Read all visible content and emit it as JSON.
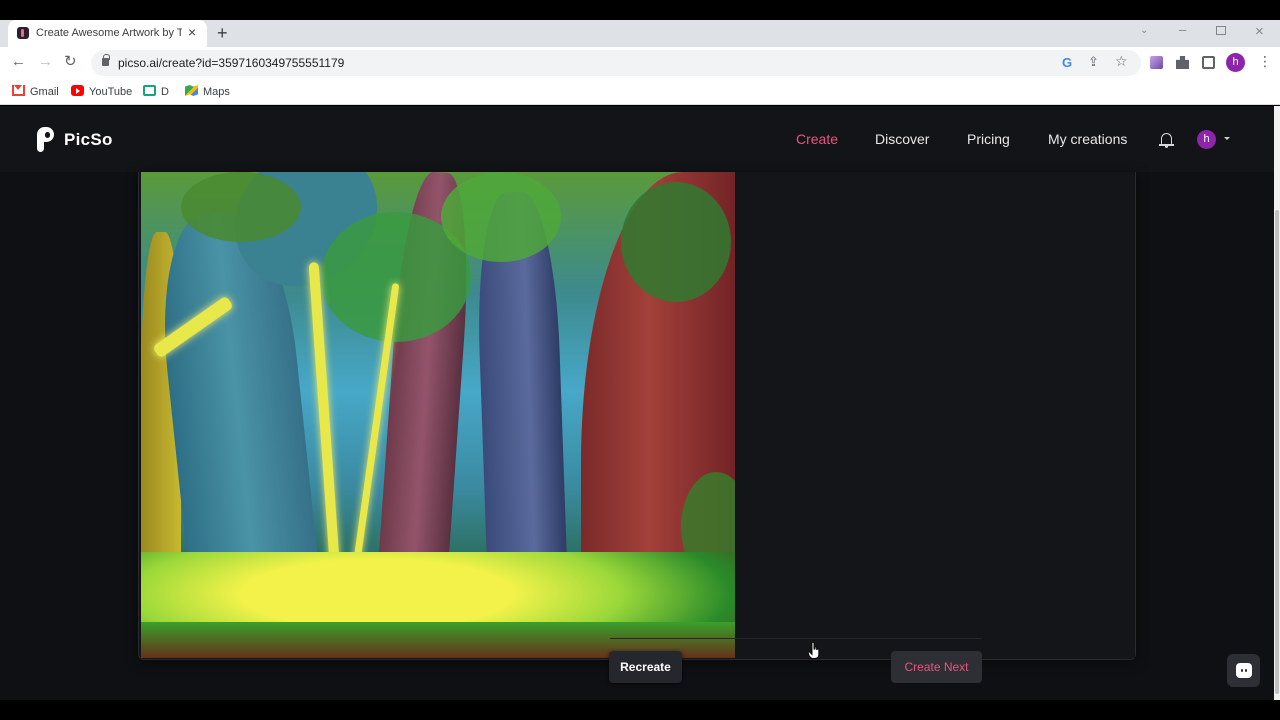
{
  "browser": {
    "tab_title": "Create Awesome Artwork by Typ",
    "url": "picso.ai/create?id=3597160349755551179",
    "profile_initial": "h",
    "bookmarks": [
      {
        "label": "Gmail",
        "icon": "gmail-icon"
      },
      {
        "label": "YouTube",
        "icon": "youtube-icon"
      },
      {
        "label": "D",
        "icon": "d-icon"
      },
      {
        "label": "Maps",
        "icon": "maps-icon"
      }
    ]
  },
  "site": {
    "brand": "PicSo",
    "brand_color": "#e75480",
    "nav": {
      "create": "Create",
      "discover": "Discover",
      "pricing": "Pricing",
      "my_creations": "My creations"
    },
    "active_nav": "Create",
    "user_initial": "h"
  },
  "result": {
    "artwork_description_icon": "forest-painting-image",
    "recreate_label": "Recreate",
    "create_next_label": "Create Next"
  },
  "icons": {
    "bell": "bell-icon",
    "chat": "chat-icon",
    "cursor": "hand-cursor-icon"
  }
}
